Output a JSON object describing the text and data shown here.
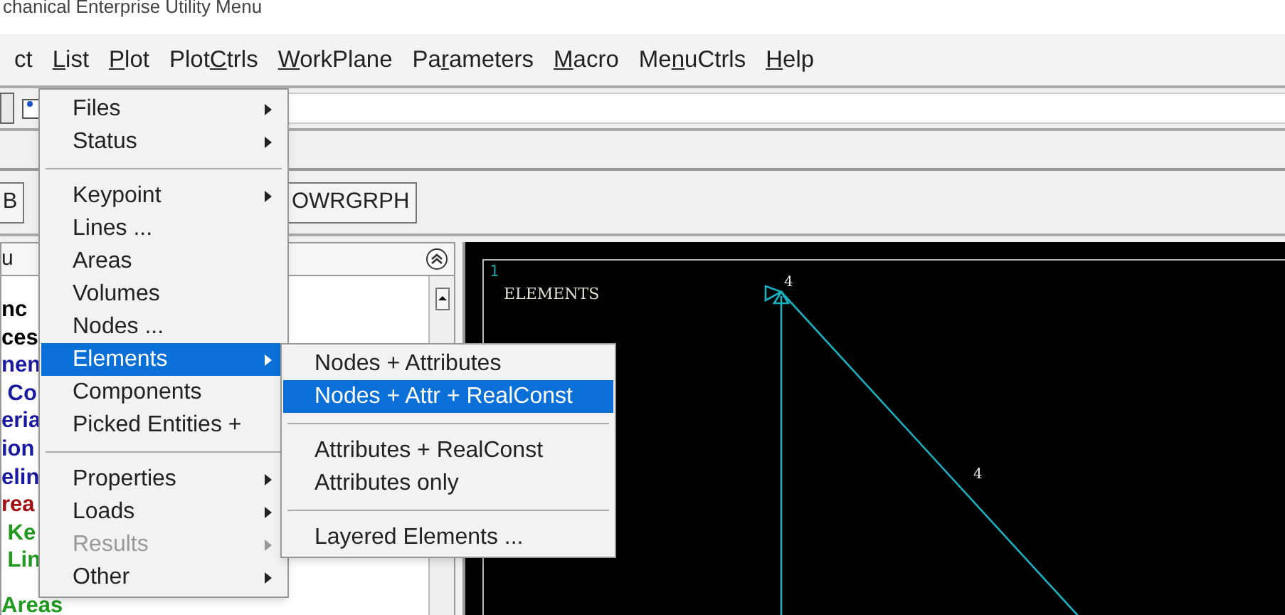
{
  "window": {
    "title": "chanical Enterprise Utility Menu"
  },
  "menubar": [
    {
      "before": "ct"
    },
    {
      "key": "L",
      "after": "ist"
    },
    {
      "key": "P",
      "after": "lot"
    },
    {
      "before": "Plot",
      "key": "C",
      "after": "trls"
    },
    {
      "key": "W",
      "after": "orkPlane"
    },
    {
      "before": "Pa",
      "key": "r",
      "after": "ameters"
    },
    {
      "key": "M",
      "after": "acro"
    },
    {
      "before": "Me",
      "key": "n",
      "after": "uCtrls"
    },
    {
      "key": "H",
      "after": "elp"
    }
  ],
  "toolbar_buttons": [
    "B",
    "OWRGRPH"
  ],
  "main_menu": {
    "title": "u",
    "items": [
      {
        "text": "nc",
        "color": "#000000"
      },
      {
        "text": "ces",
        "color": "#000000"
      },
      {
        "text": "nen",
        "color": "#1a1aa0"
      },
      {
        "text": " Co",
        "color": "#1a1aa0"
      },
      {
        "text": "eria",
        "color": "#1a1aa0"
      },
      {
        "text": "ion",
        "color": "#1a1aa0"
      },
      {
        "text": "elin",
        "color": "#1a1aa0"
      },
      {
        "text": "rea",
        "color": "#a01010"
      },
      {
        "text": " Ke",
        "color": "#1f9a1f"
      },
      {
        "text": " Lin",
        "color": "#1f9a1f"
      },
      {
        "text": "Areas",
        "color": "#1f9a1f"
      }
    ]
  },
  "graphics": {
    "window_number": "1",
    "title": "ELEMENTS",
    "labels": [
      "4",
      "4"
    ]
  },
  "dropdown": [
    {
      "kind": "item",
      "label": "Files",
      "submenu": true,
      "selected": false,
      "disabled": false
    },
    {
      "kind": "item",
      "label": "Status",
      "submenu": true,
      "selected": false,
      "disabled": false
    },
    {
      "kind": "separator"
    },
    {
      "kind": "item",
      "label": "Keypoint",
      "submenu": true,
      "selected": false,
      "disabled": false
    },
    {
      "kind": "item",
      "label": "Lines ...",
      "submenu": false,
      "selected": false,
      "disabled": false
    },
    {
      "kind": "item",
      "label": "Areas",
      "submenu": false,
      "selected": false,
      "disabled": false
    },
    {
      "kind": "item",
      "label": "Volumes",
      "submenu": false,
      "selected": false,
      "disabled": false
    },
    {
      "kind": "item",
      "label": "Nodes ...",
      "submenu": false,
      "selected": false,
      "disabled": false
    },
    {
      "kind": "item",
      "label": "Elements",
      "submenu": true,
      "selected": true,
      "disabled": false
    },
    {
      "kind": "item",
      "label": "Components",
      "submenu": false,
      "selected": false,
      "disabled": false
    },
    {
      "kind": "item",
      "label": "Picked Entities +",
      "submenu": false,
      "selected": false,
      "disabled": false
    },
    {
      "kind": "separator"
    },
    {
      "kind": "item",
      "label": "Properties",
      "submenu": true,
      "selected": false,
      "disabled": false
    },
    {
      "kind": "item",
      "label": "Loads",
      "submenu": true,
      "selected": false,
      "disabled": false
    },
    {
      "kind": "item",
      "label": "Results",
      "submenu": true,
      "selected": false,
      "disabled": true
    },
    {
      "kind": "item",
      "label": "Other",
      "submenu": true,
      "selected": false,
      "disabled": false
    }
  ],
  "submenu": [
    {
      "kind": "item",
      "label": "Nodes + Attributes",
      "selected": false
    },
    {
      "kind": "item",
      "label": "Nodes + Attr + RealConst",
      "selected": true
    },
    {
      "kind": "separator"
    },
    {
      "kind": "item",
      "label": "Attributes + RealConst",
      "selected": false
    },
    {
      "kind": "item",
      "label": "Attributes only",
      "selected": false
    },
    {
      "kind": "separator"
    },
    {
      "kind": "item",
      "label": "Layered Elements ...",
      "selected": false
    }
  ]
}
